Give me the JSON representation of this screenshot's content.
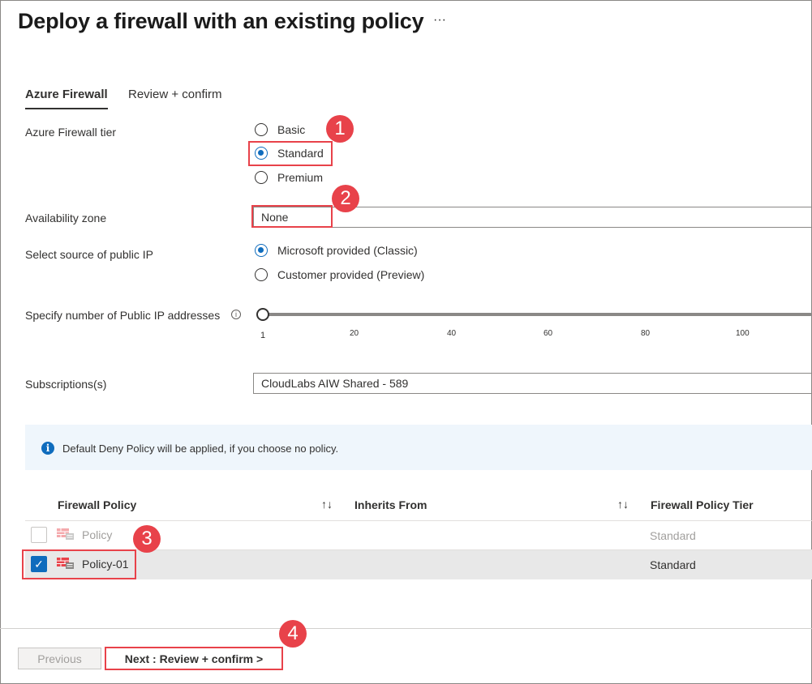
{
  "page": {
    "title": "Deploy a firewall with an existing policy",
    "more_label": "···"
  },
  "tabs": [
    {
      "label": "Azure Firewall",
      "active": true
    },
    {
      "label": "Review + confirm",
      "active": false
    }
  ],
  "tier": {
    "label": "Azure Firewall tier",
    "options": [
      "Basic",
      "Standard",
      "Premium"
    ],
    "selected": "Standard"
  },
  "availability_zone": {
    "label": "Availability zone",
    "value": "None"
  },
  "public_ip_source": {
    "label": "Select source of public IP",
    "options": [
      "Microsoft provided (Classic)",
      "Customer provided (Preview)"
    ],
    "selected": "Microsoft provided (Classic)"
  },
  "public_ip_count": {
    "label": "Specify number of Public IP addresses",
    "value": 1,
    "ticks": [
      "1",
      "20",
      "40",
      "60",
      "80",
      "100"
    ]
  },
  "subscriptions": {
    "label": "Subscriptions(s)",
    "value": "CloudLabs AIW Shared - 589"
  },
  "info": {
    "text": "Default Deny Policy will be applied, if you choose no policy."
  },
  "table": {
    "headers": [
      "Firewall Policy",
      "Inherits From",
      "Firewall Policy Tier"
    ],
    "sort_glyph": "↑↓",
    "rows": [
      {
        "name": "Policy",
        "inherits": "",
        "tier": "Standard",
        "checked": false,
        "disabled": true
      },
      {
        "name": "Policy-01",
        "inherits": "",
        "tier": "Standard",
        "checked": true,
        "disabled": false
      }
    ]
  },
  "footer": {
    "previous_label": "Previous",
    "next_label": "Next : Review + confirm >"
  },
  "callouts": [
    "1",
    "2",
    "3",
    "4"
  ],
  "colors": {
    "accent": "#0f6cbd",
    "callout": "#e8424a",
    "info_bg": "#eff6fc"
  }
}
